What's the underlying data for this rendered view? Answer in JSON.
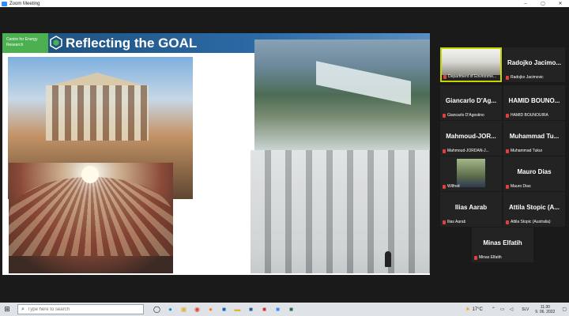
{
  "window": {
    "title": "Zoom Meeting",
    "controls": [
      "–",
      "▢",
      "✕"
    ]
  },
  "slide": {
    "org_name": "Centre for Energy Research",
    "heading": "Reflecting the GOAL"
  },
  "gallery": [
    {
      "display_name": "",
      "label": "Department of Environme...",
      "active": true,
      "has_video": true
    },
    {
      "display_name": "Radojko Jacimo...",
      "label": "Radojko Jacimovic",
      "active": false,
      "has_video": false
    },
    {
      "display_name": "Giancarlo D'Ag...",
      "label": "Giancarlo D'Agostino",
      "active": false,
      "has_video": false
    },
    {
      "display_name": "HAMID BOUNO...",
      "label": "HAMID BOUNOUIRA",
      "active": false,
      "has_video": false
    },
    {
      "display_name": "Mahmoud-JOR...",
      "label": "Mahmoud-JORDAN-J...",
      "active": false,
      "has_video": false
    },
    {
      "display_name": "Muhammad Tu...",
      "label": "Muhammad Tukur",
      "active": false,
      "has_video": false
    },
    {
      "display_name": "",
      "label": "Wilfred",
      "active": false,
      "has_video": true
    },
    {
      "display_name": "Mauro Dias",
      "label": "Mauro Dias",
      "active": false,
      "has_video": false
    },
    {
      "display_name": "Ilias Aarab",
      "label": "Ilias Aarab",
      "active": false,
      "has_video": false
    },
    {
      "display_name": "Attila Stopic (A...",
      "label": "Attila Stopic (Australia)",
      "active": false,
      "has_video": false
    },
    {
      "display_name": "Minas Elfatih",
      "label": "Minas Elfatih",
      "active": false,
      "has_video": false
    }
  ],
  "taskbar": {
    "search_placeholder": "Type here to search",
    "weather": "17°C",
    "language": "SLV",
    "time": "11:30",
    "date": "9. 06. 2022",
    "apps": [
      "task-view",
      "edge",
      "explorer",
      "chrome",
      "firefox",
      "outlook",
      "folder",
      "word",
      "pdf",
      "zoom",
      "excel"
    ]
  },
  "colors": {
    "accent": "#2d8cff",
    "active_speaker": "#c7d400",
    "slide_header": "#1d4e79",
    "org_green": "#4caf50"
  }
}
